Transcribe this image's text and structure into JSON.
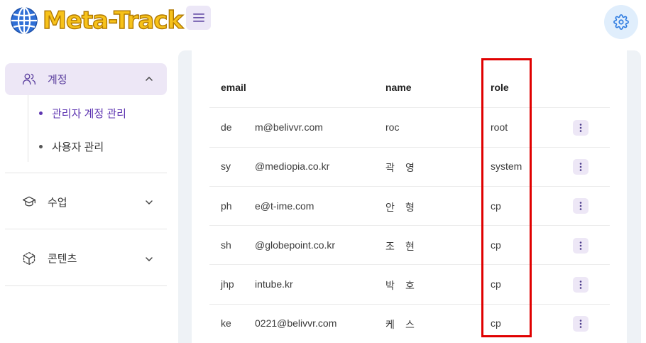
{
  "header": {
    "logo_text": "Meta-Track",
    "menu_icon": "hamburger-menu-icon",
    "settings_icon": "gear-icon"
  },
  "sidebar": {
    "items": [
      {
        "label": "계정",
        "icon": "users-icon",
        "expanded": true,
        "children": [
          {
            "label": "관리자 계정 관리",
            "active": true
          },
          {
            "label": "사용자 관리",
            "active": false
          }
        ]
      },
      {
        "label": "수업",
        "icon": "graduation-cap-icon",
        "expanded": false
      },
      {
        "label": "콘텐츠",
        "icon": "cube-icon",
        "expanded": false
      }
    ]
  },
  "table": {
    "columns": [
      "email",
      "name",
      "role"
    ],
    "rows": [
      {
        "email_prefix": "de",
        "email_suffix": "m@belivvr.com",
        "name_prefix": "roc",
        "name_suffix": "",
        "role": "root"
      },
      {
        "email_prefix": "sy",
        "email_suffix": "@mediopia.co.kr",
        "name_prefix": "곽",
        "name_suffix": "영",
        "role": "system"
      },
      {
        "email_prefix": "ph",
        "email_suffix": "e@t-ime.com",
        "name_prefix": "안",
        "name_suffix": "형",
        "role": "cp"
      },
      {
        "email_prefix": "sh",
        "email_suffix": "@globepoint.co.kr",
        "name_prefix": "조",
        "name_suffix": "현",
        "role": "cp"
      },
      {
        "email_prefix": "jhp",
        "email_suffix": "intube.kr",
        "name_prefix": "박",
        "name_suffix": "호",
        "role": "cp"
      },
      {
        "email_prefix": "ke",
        "email_suffix": "0221@belivvr.com",
        "name_prefix": "케",
        "name_suffix": "스",
        "role": "cp"
      }
    ]
  },
  "colors": {
    "accent": "#5e35b1",
    "active_bg": "#ede7f6",
    "highlight": "#e00000",
    "logo": "#f7c21a"
  }
}
